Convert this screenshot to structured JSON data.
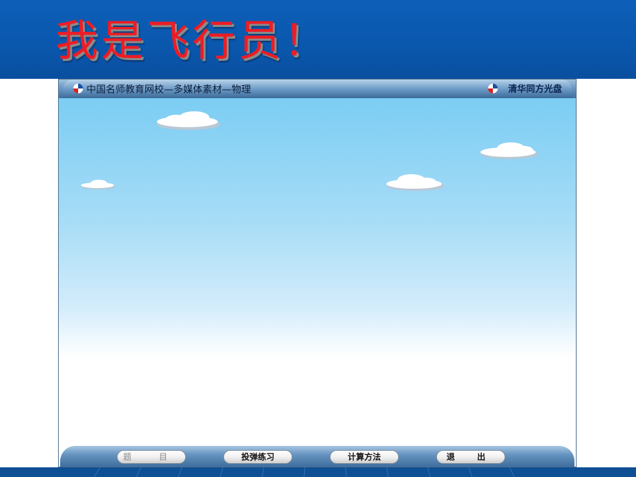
{
  "slide": {
    "title": "我是飞行员！"
  },
  "window": {
    "title": "中国名师教育网校—多媒体素材—物理",
    "brand": "清华同方光盘"
  },
  "controls": [
    {
      "label": "题 目"
    },
    {
      "label": "投弹练习"
    },
    {
      "label": "计算方法"
    },
    {
      "label": "退 出"
    }
  ],
  "colors": {
    "banner": "#0a57ad",
    "title_text": "#ee1c24",
    "title_bar": "#6f9cc7",
    "sky_top": "#7ccdf4"
  }
}
